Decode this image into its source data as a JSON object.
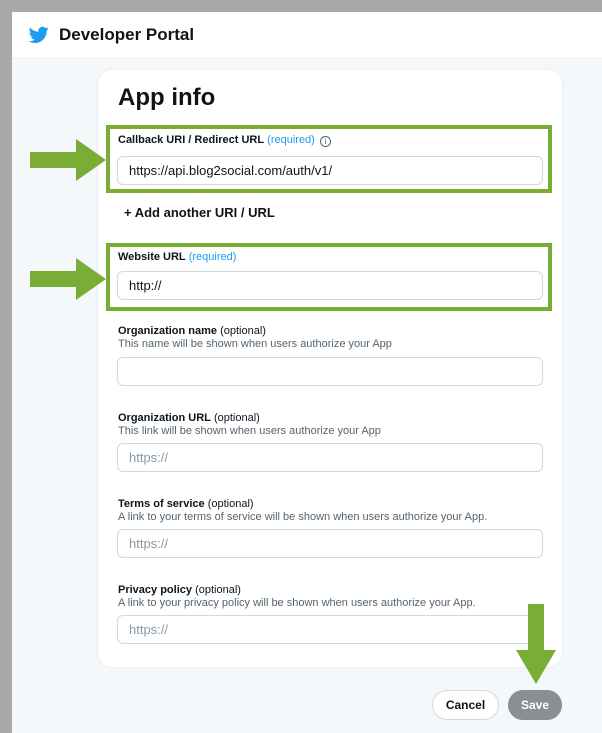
{
  "header": {
    "title": "Developer Portal",
    "bird_color": "#1d9bf0"
  },
  "card": {
    "title": "App info",
    "callback": {
      "label": "Callback URI / Redirect URL",
      "required": "(required)",
      "info_icon": "info-icon",
      "value": "https://api.blog2social.com/auth/v1/"
    },
    "add_another": "+ Add another URI / URL",
    "website": {
      "label": "Website URL",
      "required": "(required)",
      "value": "http://"
    },
    "org_name": {
      "label": "Organization name",
      "optional": "(optional)",
      "hint": "This name will be shown when users authorize your App",
      "value": ""
    },
    "org_url": {
      "label": "Organization URL",
      "optional": "(optional)",
      "hint": "This link will be shown when users authorize your App",
      "placeholder": "https://"
    },
    "terms": {
      "label": "Terms of service",
      "optional": "(optional)",
      "hint": "A link to your terms of service will be shown when users authorize your App.",
      "placeholder": "https://"
    },
    "privacy": {
      "label": "Privacy policy",
      "optional": "(optional)",
      "hint": "A link to your privacy policy will be shown when users authorize your App.",
      "placeholder": "https://"
    }
  },
  "buttons": {
    "cancel": "Cancel",
    "save": "Save"
  },
  "annotation": {
    "highlight_color": "#79ad35",
    "arrow_color": "#79ad35"
  }
}
